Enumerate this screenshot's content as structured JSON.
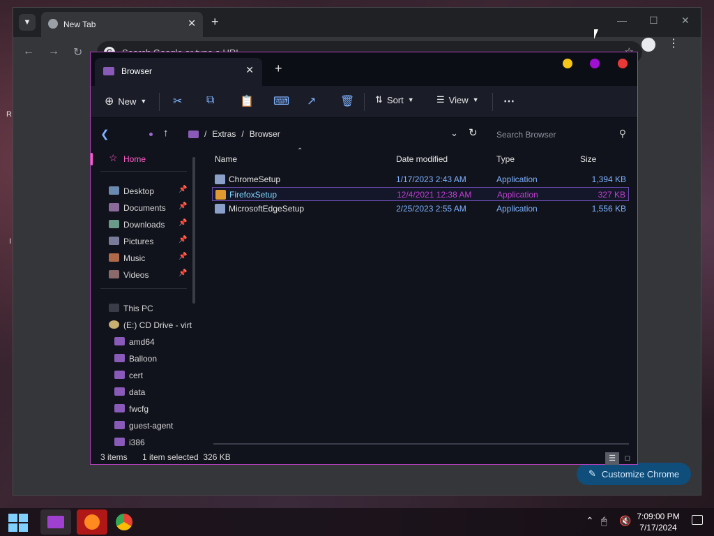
{
  "wallpaper_fragments": [
    "R",
    "I"
  ],
  "chrome": {
    "tab_title": "New Tab",
    "omnibox_placeholder": "Search Google or type a URL",
    "customize_label": "Customize Chrome"
  },
  "explorer": {
    "tab_title": "Browser",
    "toolbar": {
      "new_label": "New",
      "sort_label": "Sort",
      "view_label": "View"
    },
    "breadcrumb": [
      "Extras",
      "Browser"
    ],
    "search_placeholder": "Search Browser",
    "nav": {
      "home": "Home",
      "quick_access": [
        {
          "label": "Desktop",
          "color": "#6a8ab0"
        },
        {
          "label": "Documents",
          "color": "#8a6a9a"
        },
        {
          "label": "Downloads",
          "color": "#6a9a8a"
        },
        {
          "label": "Pictures",
          "color": "#7a7a9a"
        },
        {
          "label": "Music",
          "color": "#b06a4a"
        },
        {
          "label": "Videos",
          "color": "#8a6a6a"
        }
      ],
      "this_pc": "This PC",
      "drive": "(E:) CD Drive - virt",
      "folders": [
        "amd64",
        "Balloon",
        "cert",
        "data",
        "fwcfg",
        "guest-agent",
        "i386"
      ]
    },
    "columns": {
      "name": "Name",
      "date": "Date modified",
      "type": "Type",
      "size": "Size"
    },
    "files": [
      {
        "name": "ChromeSetup",
        "date": "1/17/2023 2:43 AM",
        "type": "Application",
        "size": "1,394 KB",
        "selected": false,
        "icon_color": "#8aa0c8"
      },
      {
        "name": "FirefoxSetup",
        "date": "12/4/2021 12:38 AM",
        "type": "Application",
        "size": "327 KB",
        "selected": true,
        "icon_color": "#e09a30"
      },
      {
        "name": "MicrosoftEdgeSetup",
        "date": "2/25/2023 2:55 AM",
        "type": "Application",
        "size": "1,556 KB",
        "selected": false,
        "icon_color": "#8aa0c8"
      }
    ],
    "status": {
      "count": "3 items",
      "selection": "1 item selected  326 KB"
    },
    "accent": "#b040b8"
  },
  "taskbar": {
    "time": "7:09:00 PM",
    "date": "7/17/2024"
  }
}
